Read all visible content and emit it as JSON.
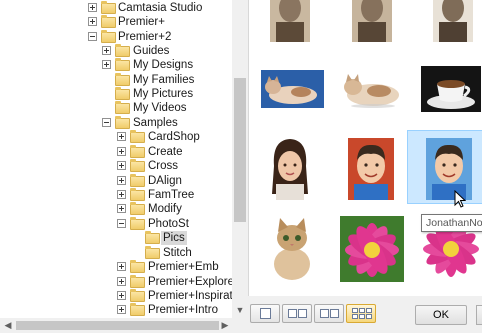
{
  "tree": {
    "items": [
      {
        "label": "Camtasia Studio",
        "expander": "plus"
      },
      {
        "label": "Premier+",
        "expander": "plus"
      },
      {
        "label": "Premier+2",
        "expander": "minus"
      },
      {
        "label": "Guides",
        "expander": "plus"
      },
      {
        "label": "My Designs",
        "expander": "plus"
      },
      {
        "label": "My Families",
        "expander": "none"
      },
      {
        "label": "My Pictures",
        "expander": "none"
      },
      {
        "label": "My Videos",
        "expander": "none"
      },
      {
        "label": "Samples",
        "expander": "minus"
      },
      {
        "label": "CardShop",
        "expander": "plus"
      },
      {
        "label": "Create",
        "expander": "plus"
      },
      {
        "label": "Cross",
        "expander": "plus"
      },
      {
        "label": "DAlign",
        "expander": "plus"
      },
      {
        "label": "FamTree",
        "expander": "plus"
      },
      {
        "label": "Modify",
        "expander": "plus"
      },
      {
        "label": "PhotoSt",
        "expander": "minus"
      },
      {
        "label": "Pics",
        "expander": "none",
        "selected": true
      },
      {
        "label": "Stitch",
        "expander": "none"
      },
      {
        "label": "Premier+Emb",
        "expander": "plus"
      },
      {
        "label": "Premier+Explorer",
        "expander": "plus"
      },
      {
        "label": "Premier+Inspiration",
        "expander": "plus"
      },
      {
        "label": "Premier+Intro",
        "expander": "plus"
      }
    ]
  },
  "thumbnails": {
    "tooltip": "JonathanNoBa",
    "items": [
      {
        "name": "sepia-boy-photo-1"
      },
      {
        "name": "sepia-boy-photo-2"
      },
      {
        "name": "sepia-boy-photo-3"
      },
      {
        "name": "cat-on-blue-photo"
      },
      {
        "name": "lying-cat-photo"
      },
      {
        "name": "coffee-cup-photo"
      },
      {
        "name": "girl-portrait-photo"
      },
      {
        "name": "boy-red-background-photo"
      },
      {
        "name": "boy-blue-background-photo",
        "selected": true
      },
      {
        "name": "kitten-photo"
      },
      {
        "name": "pink-flower-photo"
      },
      {
        "name": "pink-flower-cutout-photo"
      }
    ]
  },
  "toolbar": {
    "ok_label": "OK",
    "view_modes": [
      "single-view",
      "two-up-view",
      "side-by-side-view",
      "grid-view"
    ],
    "active_view": "grid-view"
  },
  "colors": {
    "selection": "#cce8ff",
    "selection_border": "#99d1ff",
    "folder": "#f0cc6a",
    "active_view_button": "#f6d77c"
  }
}
